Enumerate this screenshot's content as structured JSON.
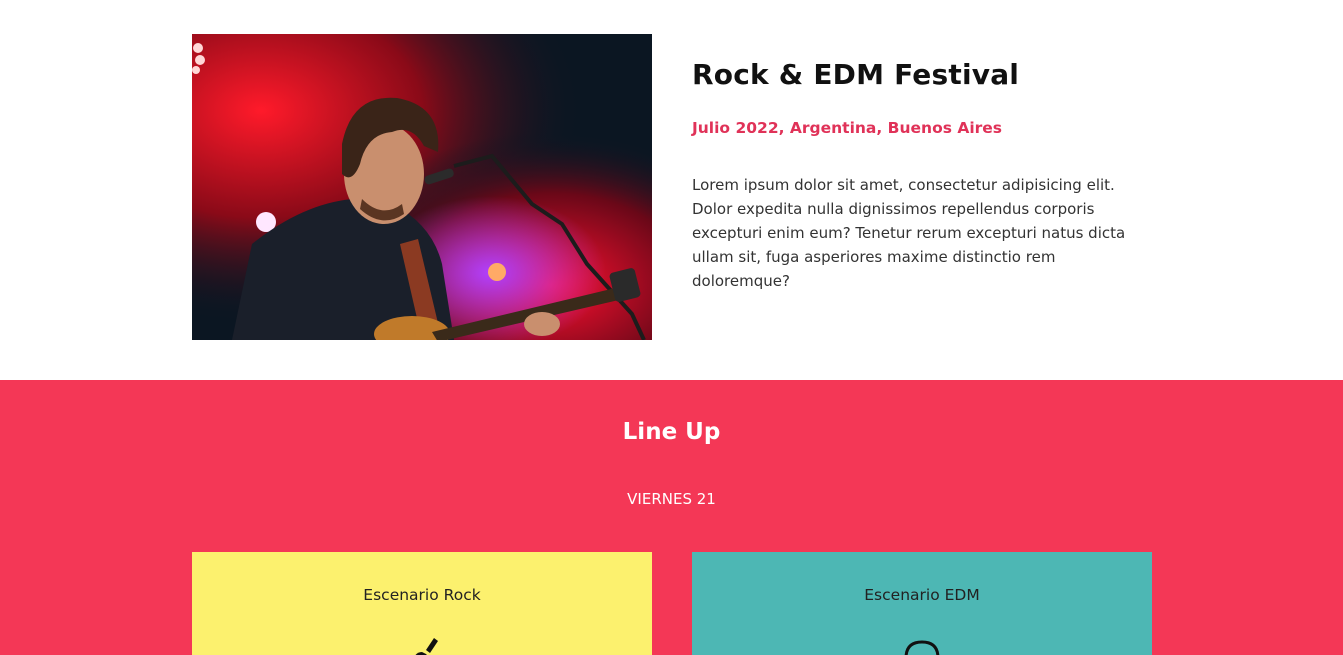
{
  "festival": {
    "title": "Rock & EDM Festival",
    "date_location": "Julio 2022, Argentina, Buenos Aires",
    "description": "Lorem ipsum dolor sit amet, consectetur adipisicing elit. Dolor expedita nulla dignissimos repellendus corporis excepturi enim eum? Tenetur rerum excepturi natus dicta ullam sit, fuga asperiores maxime distinctio rem doloremque?",
    "image_alt": "Singer with guitar on stage"
  },
  "lineup": {
    "title": "Line Up",
    "day": "VIERNES 21",
    "stages": [
      {
        "name": "Escenario Rock",
        "icon": "guitar-icon",
        "color": "#fcf16e"
      },
      {
        "name": "Escenario EDM",
        "icon": "headphones-icon",
        "color": "#4db7b4"
      }
    ]
  },
  "colors": {
    "accent": "#f43756",
    "subtitle": "#e03258"
  }
}
